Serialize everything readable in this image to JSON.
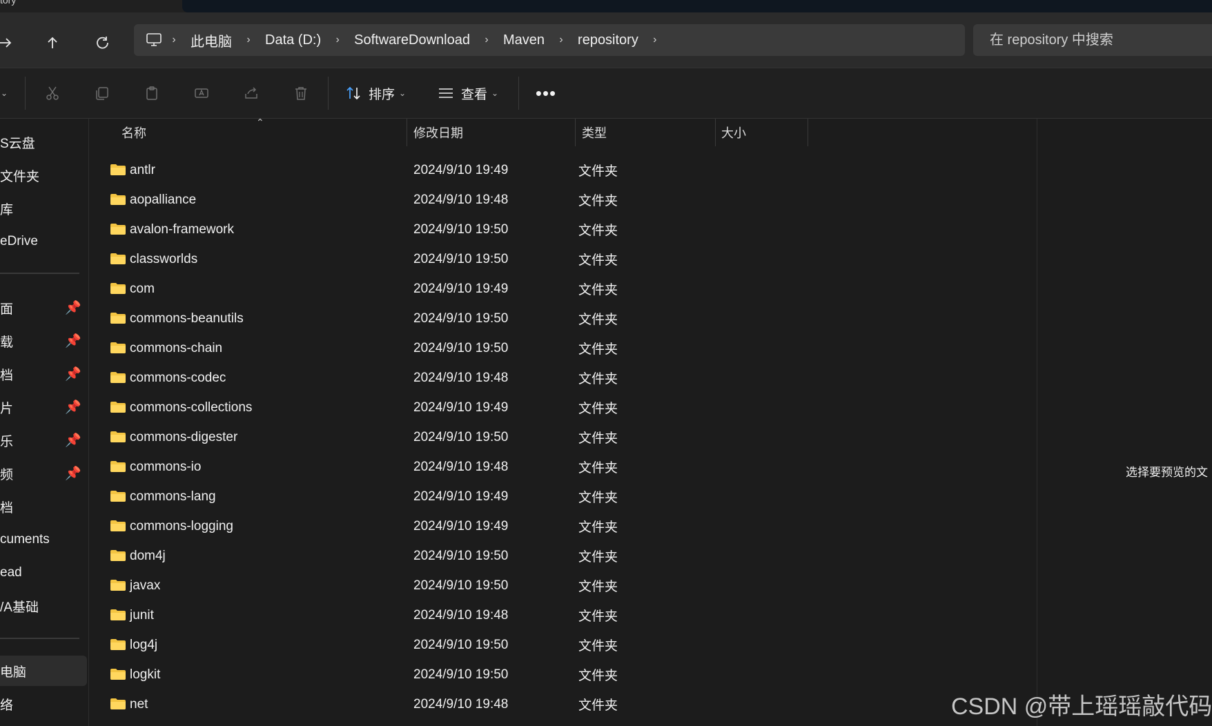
{
  "window": {
    "tab_title_fragment": "tory"
  },
  "nav": {
    "back_icon": "arrow-right-icon",
    "up_icon": "arrow-up-icon",
    "refresh_icon": "refresh-icon"
  },
  "breadcrumb": {
    "items": [
      "此电脑",
      "Data (D:)",
      "SoftwareDownload",
      "Maven",
      "repository"
    ]
  },
  "search": {
    "placeholder": "在 repository 中搜索"
  },
  "toolbar": {
    "sort_label": "排序",
    "view_label": "查看"
  },
  "sidebar": {
    "items": [
      {
        "label": "S云盘",
        "pinned": false
      },
      {
        "label": "文件夹",
        "pinned": false
      },
      {
        "label": "库",
        "pinned": false
      },
      {
        "label": "eDrive",
        "pinned": false
      },
      {
        "label": "面",
        "pinned": true
      },
      {
        "label": "载",
        "pinned": true
      },
      {
        "label": "档",
        "pinned": true
      },
      {
        "label": "片",
        "pinned": true
      },
      {
        "label": "乐",
        "pinned": true
      },
      {
        "label": "频",
        "pinned": true
      },
      {
        "label": "档",
        "pinned": false
      },
      {
        "label": "cuments",
        "pinned": false
      },
      {
        "label": "ead",
        "pinned": false
      },
      {
        "label": "/A基础",
        "pinned": false
      },
      {
        "label": "电脑",
        "pinned": false,
        "selected": true
      },
      {
        "label": "络",
        "pinned": false
      }
    ]
  },
  "columns": {
    "name": "名称",
    "modified": "修改日期",
    "type": "类型",
    "size": "大小"
  },
  "files": [
    {
      "name": "antlr",
      "modified": "2024/9/10 19:49",
      "type": "文件夹"
    },
    {
      "name": "aopalliance",
      "modified": "2024/9/10 19:48",
      "type": "文件夹"
    },
    {
      "name": "avalon-framework",
      "modified": "2024/9/10 19:50",
      "type": "文件夹"
    },
    {
      "name": "classworlds",
      "modified": "2024/9/10 19:50",
      "type": "文件夹"
    },
    {
      "name": "com",
      "modified": "2024/9/10 19:49",
      "type": "文件夹"
    },
    {
      "name": "commons-beanutils",
      "modified": "2024/9/10 19:50",
      "type": "文件夹"
    },
    {
      "name": "commons-chain",
      "modified": "2024/9/10 19:50",
      "type": "文件夹"
    },
    {
      "name": "commons-codec",
      "modified": "2024/9/10 19:48",
      "type": "文件夹"
    },
    {
      "name": "commons-collections",
      "modified": "2024/9/10 19:49",
      "type": "文件夹"
    },
    {
      "name": "commons-digester",
      "modified": "2024/9/10 19:50",
      "type": "文件夹"
    },
    {
      "name": "commons-io",
      "modified": "2024/9/10 19:48",
      "type": "文件夹"
    },
    {
      "name": "commons-lang",
      "modified": "2024/9/10 19:49",
      "type": "文件夹"
    },
    {
      "name": "commons-logging",
      "modified": "2024/9/10 19:49",
      "type": "文件夹"
    },
    {
      "name": "dom4j",
      "modified": "2024/9/10 19:50",
      "type": "文件夹"
    },
    {
      "name": "javax",
      "modified": "2024/9/10 19:50",
      "type": "文件夹"
    },
    {
      "name": "junit",
      "modified": "2024/9/10 19:48",
      "type": "文件夹"
    },
    {
      "name": "log4j",
      "modified": "2024/9/10 19:50",
      "type": "文件夹"
    },
    {
      "name": "logkit",
      "modified": "2024/9/10 19:50",
      "type": "文件夹"
    },
    {
      "name": "net",
      "modified": "2024/9/10 19:48",
      "type": "文件夹"
    }
  ],
  "preview": {
    "message": "选择要预览的文"
  },
  "watermark": "CSDN @带上瑶瑶敲代码",
  "colors": {
    "background": "#1c1c1c",
    "toolbar": "#202020",
    "address_bar": "#3a3a3a",
    "folder": "#f4c542"
  }
}
